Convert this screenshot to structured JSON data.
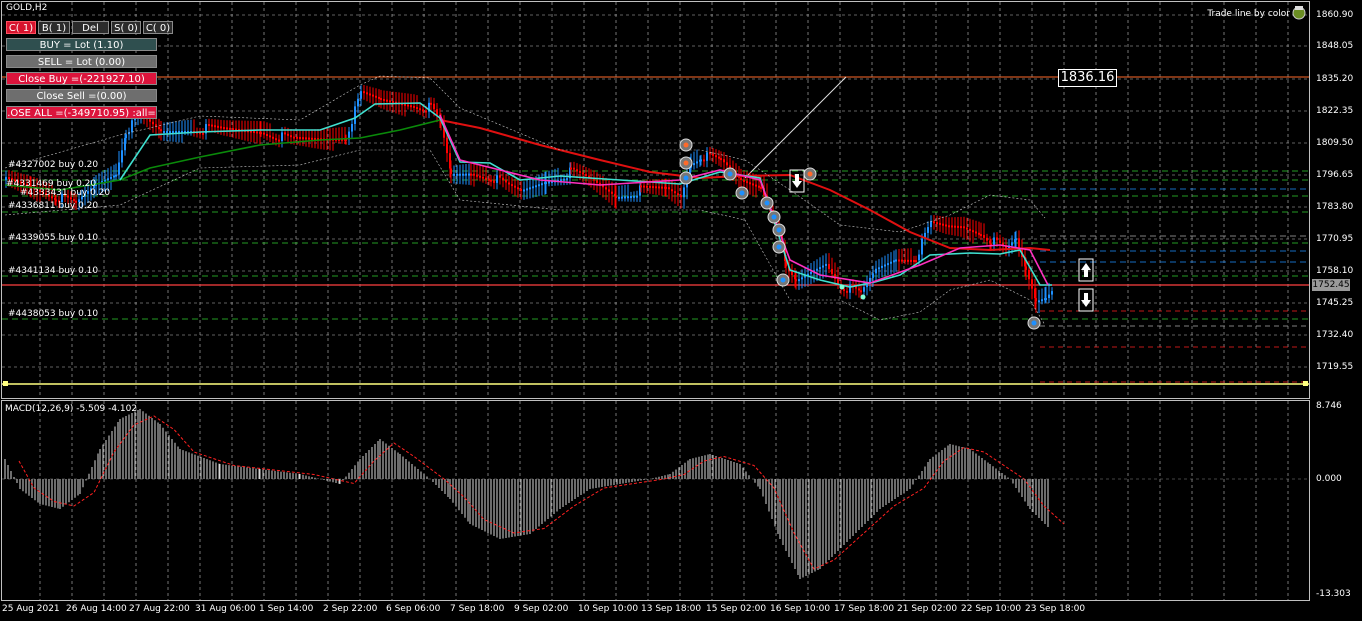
{
  "symbol": "GOLD,H2",
  "trade_line_label": "Trade line by color",
  "top_buttons": [
    "C( 1)",
    "B( 1)",
    "Del",
    "S( 0)",
    "C( 0)"
  ],
  "panel_buttons": {
    "buy": "BUY = Lot (1.10)",
    "sell": "SELL = Lot (0.00)",
    "close_buy": "Close  Buy =(-221927.10)",
    "close_sell": "Close  Sell =(0.00)",
    "close_all": ".OSE  ALL =(-349710.95) :all="
  },
  "orders": [
    {
      "label": "#4327002 buy 0.20"
    },
    {
      "label": "#4331469 buy 0.20"
    },
    {
      "label": "#4333431 buy 0.20"
    },
    {
      "label": "#4336811 buy 0.20"
    },
    {
      "label": "#4339055 buy 0.10"
    },
    {
      "label": "#4341134 buy 0.10"
    },
    {
      "label": "#4438053 buy 0.10"
    }
  ],
  "trade_line_price": "1836.16",
  "current_price": "1752.45",
  "price_axis": [
    "1860.90",
    "1848.05",
    "1835.20",
    "1822.35",
    "1809.50",
    "1796.65",
    "1783.80",
    "1770.95",
    "1758.10",
    "1745.25",
    "1732.40",
    "1719.55"
  ],
  "time_axis": [
    "25 Aug 2021",
    "26 Aug 14:00",
    "27 Aug 22:00",
    "31 Aug 06:00",
    "1 Sep 14:00",
    "2 Sep 22:00",
    "6 Sep 06:00",
    "7 Sep 18:00",
    "9 Sep 02:00",
    "10 Sep 10:00",
    "13 Sep 18:00",
    "15 Sep 02:00",
    "16 Sep 10:00",
    "17 Sep 18:00",
    "21 Sep 02:00",
    "22 Sep 10:00",
    "23 Sep 18:00"
  ],
  "macd": {
    "label": "MACD(12,26,9) -5.509 -4.102",
    "axis": [
      "8.746",
      "0.000",
      "-13.303"
    ]
  },
  "colors": {
    "bull": "#1e90ff",
    "bear": "#ff0000",
    "ma_slow": "#e01010",
    "ma_mid": "#0a8a0a",
    "ma_fast": "#40e0d0",
    "ma_magenta": "#ff30c0",
    "grid": "#c0c0c0"
  }
}
